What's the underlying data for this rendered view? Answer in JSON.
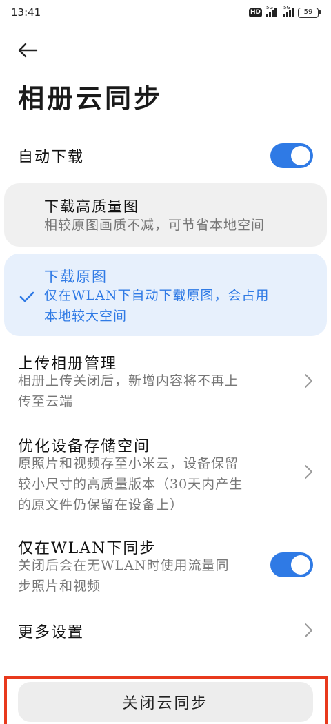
{
  "status_bar": {
    "time": "13:41",
    "hd_label": "HD",
    "network_1": "5G",
    "network_2": "5G",
    "battery": "59"
  },
  "header": {
    "back_icon": "arrow-left-icon",
    "title": "相册云同步"
  },
  "auto_download": {
    "label": "自动下载",
    "enabled": true
  },
  "download_options": [
    {
      "title": "下载高质量图",
      "subtitle": "相较原图画质不减，可节省本地空间",
      "selected": false
    },
    {
      "title": "下载原图",
      "subtitle_line1": "仅在WLAN下自动下载原图，会占用",
      "subtitle_line2": "本地较大空间",
      "selected": true
    }
  ],
  "upload_management": {
    "title": "上传相册管理",
    "subtitle_line1": "相册上传关闭后，新增内容将不再上",
    "subtitle_line2": "传至云端"
  },
  "optimize_storage": {
    "title": "优化设备存储空间",
    "subtitle_line1": "原照片和视频存至小米云，设备保留",
    "subtitle_line2": "较小尺寸的高质量版本（30天内产生",
    "subtitle_line3": "的原文件仍保留在设备上）"
  },
  "wlan_only": {
    "title": "仅在WLAN下同步",
    "subtitle_line1": "关闭后会在无WLAN时使用流量同",
    "subtitle_line2": "步照片和视频",
    "enabled": true
  },
  "more_settings": {
    "title": "更多设置"
  },
  "close_sync": {
    "label": "关闭云同步"
  },
  "colors": {
    "accent": "#2f7ae5",
    "highlight": "#e8391d"
  }
}
